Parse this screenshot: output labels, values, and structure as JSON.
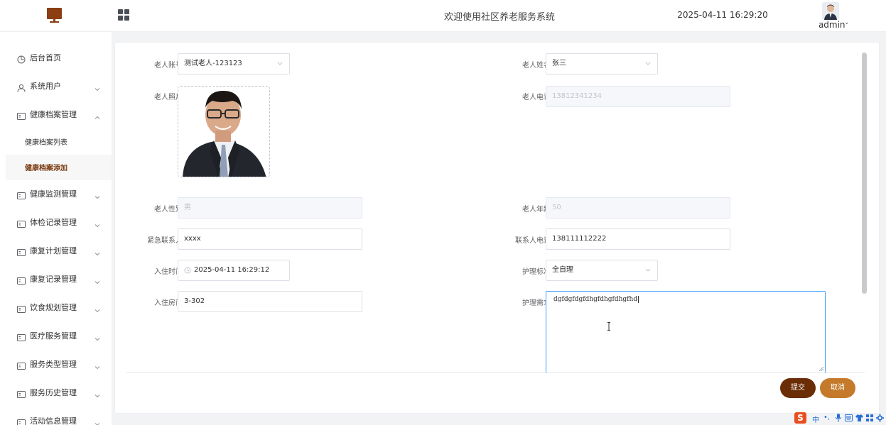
{
  "header": {
    "system_title": "欢迎使用社区养老服务系统",
    "datetime": "2025-04-11 16:29:20",
    "username": "admin",
    "user_caret": "˅"
  },
  "sidebar": {
    "items": [
      {
        "label": "后台首页",
        "icon": "clock-icon",
        "has_arrow": false
      },
      {
        "label": "系统用户",
        "icon": "user-icon",
        "has_arrow": true,
        "expanded": false
      },
      {
        "label": "健康档案管理",
        "icon": "list-icon",
        "has_arrow": true,
        "expanded": true
      },
      {
        "label": "健康监测管理",
        "icon": "list-icon",
        "has_arrow": true,
        "expanded": false
      },
      {
        "label": "体检记录管理",
        "icon": "list-icon",
        "has_arrow": true,
        "expanded": false
      },
      {
        "label": "康复计划管理",
        "icon": "list-icon",
        "has_arrow": true,
        "expanded": false
      },
      {
        "label": "康复记录管理",
        "icon": "list-icon",
        "has_arrow": true,
        "expanded": false
      },
      {
        "label": "饮食规划管理",
        "icon": "list-icon",
        "has_arrow": true,
        "expanded": false
      },
      {
        "label": "医疗服务管理",
        "icon": "list-icon",
        "has_arrow": true,
        "expanded": false
      },
      {
        "label": "服务类型管理",
        "icon": "list-icon",
        "has_arrow": true,
        "expanded": false
      },
      {
        "label": "服务历史管理",
        "icon": "list-icon",
        "has_arrow": true,
        "expanded": false
      },
      {
        "label": "活动信息管理",
        "icon": "list-icon",
        "has_arrow": true,
        "expanded": false
      }
    ],
    "submenu": [
      {
        "label": "健康档案列表",
        "active": false
      },
      {
        "label": "健康档案添加",
        "active": true
      }
    ]
  },
  "form": {
    "account": {
      "label": "老人账号",
      "value": "测试老人-123123"
    },
    "name": {
      "label": "老人姓名",
      "value": "张三"
    },
    "photo": {
      "label": "老人照片"
    },
    "phone": {
      "label": "老人电话",
      "value": "13812341234"
    },
    "gender": {
      "label": "老人性别",
      "value": "男"
    },
    "age": {
      "label": "老人年龄",
      "value": "50"
    },
    "emergency_contact": {
      "label": "紧急联系人",
      "value": "xxxx"
    },
    "contact_phone": {
      "label": "联系人电话",
      "value": "138111112222"
    },
    "checkin_time": {
      "label": "入住时间",
      "value": "2025-04-11 16:29:12"
    },
    "care_level": {
      "label": "护理标准",
      "value": "全自理"
    },
    "room": {
      "label": "入住房间",
      "value": "3-302"
    },
    "care_needs": {
      "label": "护理需求",
      "value": "dgfdgfdgfdhgfdhgfdhgfhd"
    }
  },
  "buttons": {
    "submit": "提交",
    "cancel": "取消"
  },
  "ime": {
    "logo": "S",
    "mode": "中",
    "punct": "•,"
  },
  "colors": {
    "brand": "#6b2d06",
    "accent": "#c47a2a",
    "focus": "#409eff"
  }
}
